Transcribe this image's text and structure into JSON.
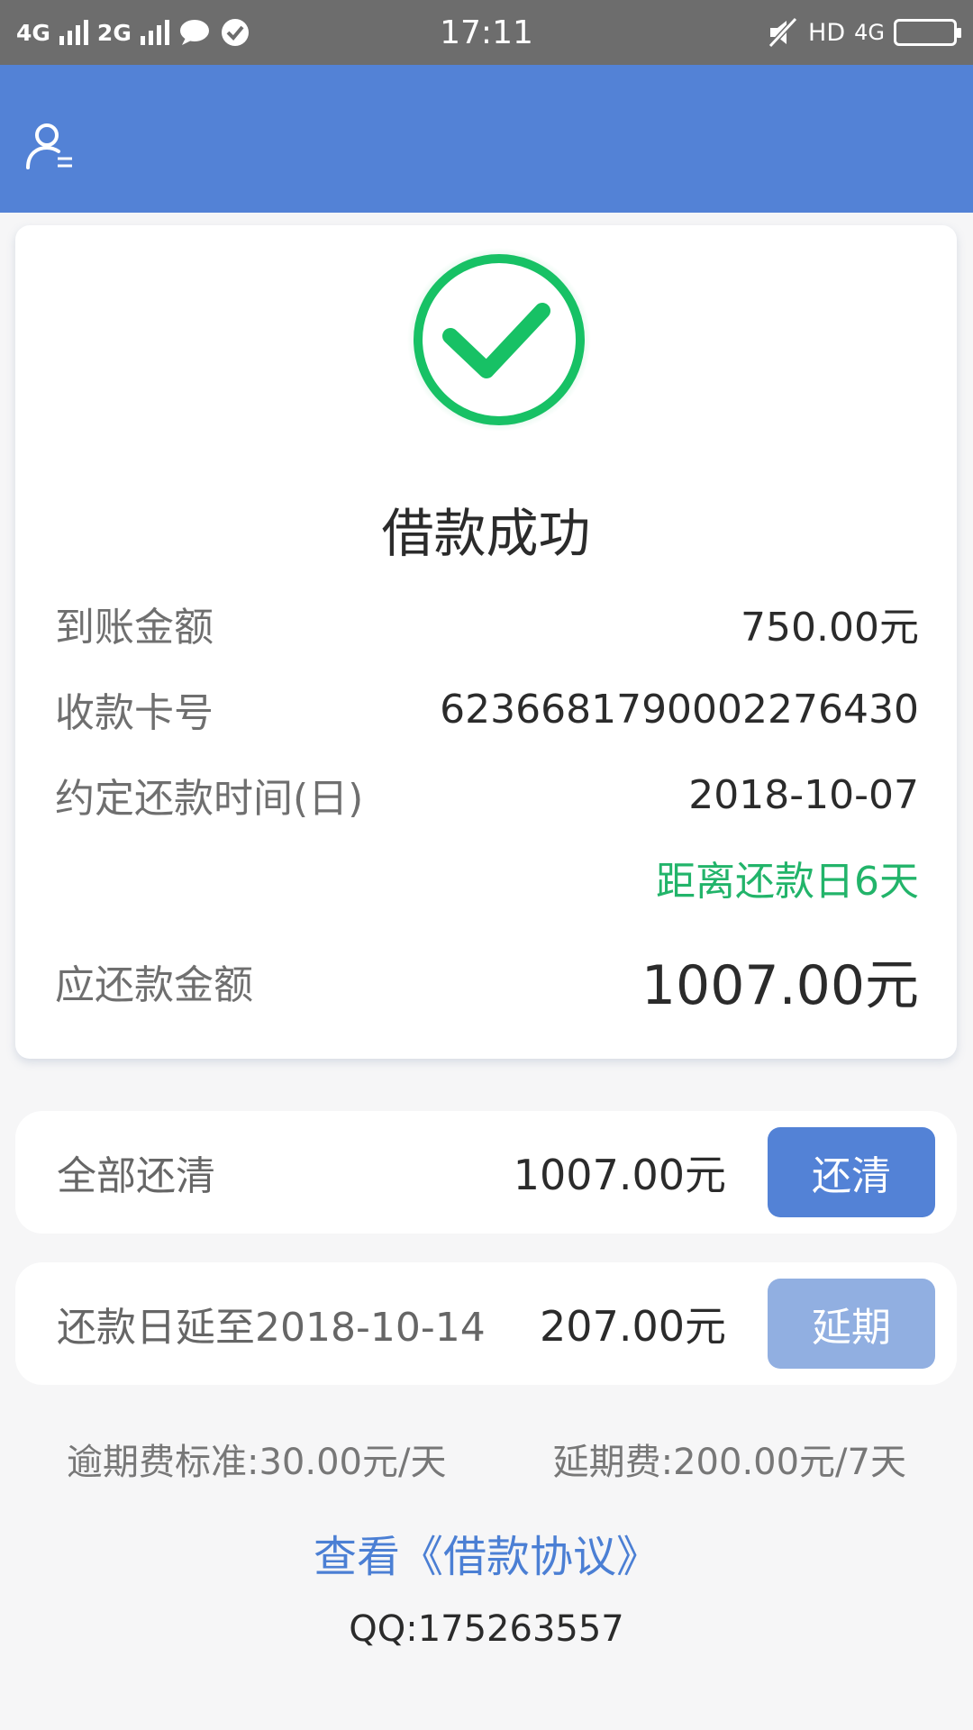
{
  "status_bar": {
    "net1": "4G",
    "net2": "2G",
    "time": "17:11",
    "hd": "HD",
    "net3": "4G"
  },
  "header": {
    "icon": "user-menu-icon"
  },
  "result": {
    "title": "借款成功",
    "icon": "success-check-icon",
    "rows": [
      {
        "label": "到账金额",
        "value": "750.00元"
      },
      {
        "label": "收款卡号",
        "value": "6236681790002276430"
      },
      {
        "label": "约定还款时间(日)",
        "value": "2018-10-07"
      }
    ],
    "countdown": "距离还款日6天",
    "due_label": "应还款金额",
    "due_value": "1007.00元"
  },
  "repay_all": {
    "label": "全部还清",
    "amount": "1007.00元",
    "button": "还清"
  },
  "extend": {
    "label": "还款日延至2018-10-14",
    "amount": "207.00元",
    "button": "延期"
  },
  "fees": {
    "overdue": "逾期费标准:30.00元/天",
    "extension": "延期费:200.00元/7天"
  },
  "agreement_link": "查看《借款协议》",
  "qq": "QQ:175263557",
  "colors": {
    "primary": "#5382d6",
    "success": "#22b46a",
    "disabled": "#91afe1"
  }
}
